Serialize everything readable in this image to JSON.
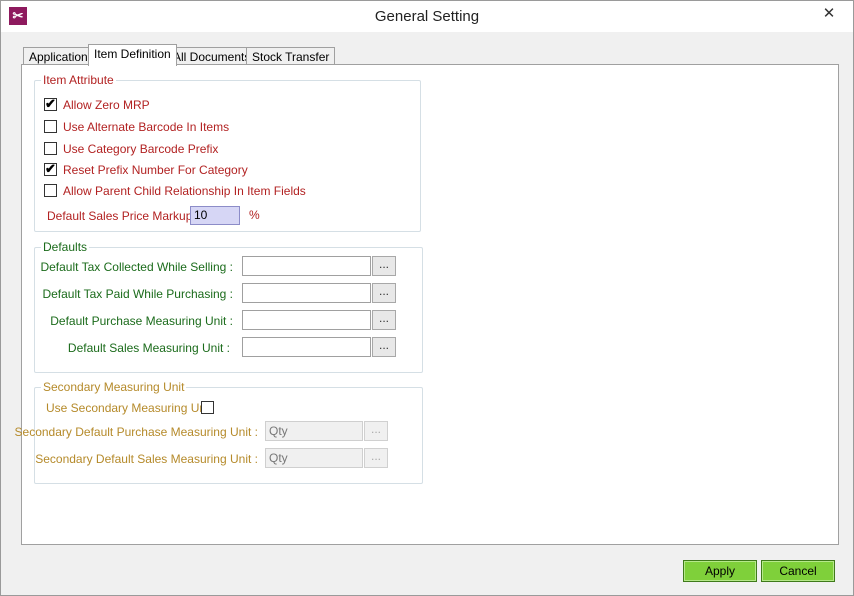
{
  "window": {
    "title": "General Setting",
    "close_glyph": "✕",
    "icon": "app-logo-icon"
  },
  "tabs": [
    {
      "label": "Application",
      "active": false
    },
    {
      "label": "Item Definition",
      "active": true
    },
    {
      "label": "All Documents",
      "active": false
    },
    {
      "label": "Stock Transfer",
      "active": false
    }
  ],
  "item_attribute": {
    "title": "Item Attribute",
    "checkboxes": [
      {
        "label": "Allow Zero MRP",
        "checked": true
      },
      {
        "label": "Use Alternate Barcode In Items",
        "checked": false
      },
      {
        "label": "Use Category Barcode Prefix",
        "checked": false
      },
      {
        "label": "Reset Prefix Number For Category",
        "checked": true
      },
      {
        "label": "Allow Parent Child Relationship In Item Fields",
        "checked": false
      }
    ],
    "markup_label": "Default Sales Price Markup :",
    "markup_value": "10",
    "markup_unit": "%"
  },
  "defaults": {
    "title": "Defaults",
    "fields": [
      {
        "label": "Default Tax Collected  While Selling :",
        "value": ""
      },
      {
        "label": "Default Tax Paid While Purchasing :",
        "value": ""
      },
      {
        "label": "Default Purchase Measuring Unit :",
        "value": ""
      },
      {
        "label": "Default Sales Measuring Unit :",
        "value": ""
      }
    ],
    "browse_label": "..."
  },
  "secondary": {
    "title": "Secondary Measuring Unit",
    "use_label": "Use Secondary Measuring Unit",
    "use_checked": false,
    "fields": [
      {
        "label": "Secondary Default Purchase Measuring Unit :",
        "value": "Qty"
      },
      {
        "label": "Secondary Default Sales Measuring Unit :",
        "value": "Qty"
      }
    ],
    "browse_label": "..."
  },
  "buttons": {
    "apply": "Apply",
    "cancel": "Cancel"
  },
  "colors": {
    "accent_button": "#7fd03a",
    "label_red": "#b22222",
    "label_green": "#1b6b1b",
    "label_gold": "#b58a2a"
  }
}
